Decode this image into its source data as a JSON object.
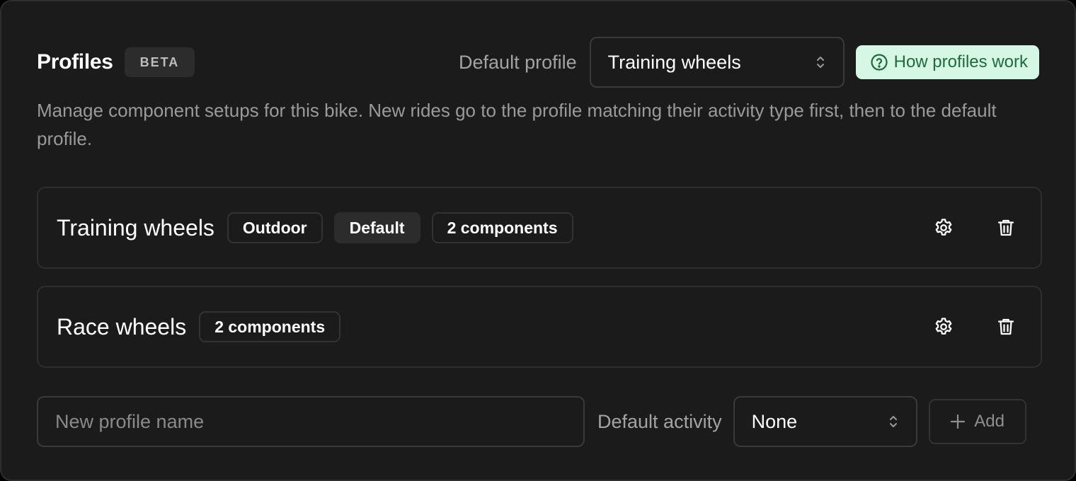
{
  "header": {
    "title": "Profiles",
    "badge": "BETA",
    "default_profile_label": "Default profile",
    "default_profile_value": "Training wheels",
    "help_button_label": "How profiles work"
  },
  "description": "Manage component setups for this bike. New rides go to the profile matching their activity type first, then to the default profile.",
  "profiles": [
    {
      "name": "Training wheels",
      "chips": [
        "Outdoor",
        "Default",
        "2 components"
      ]
    },
    {
      "name": "Race wheels",
      "chips": [
        "2 components"
      ]
    }
  ],
  "add_form": {
    "name_placeholder": "New profile name",
    "activity_label": "Default activity",
    "activity_value": "None",
    "add_label": "Add"
  },
  "icons": {
    "help": "question-circle-icon",
    "select_chevron": "chevron-up-down-icon",
    "settings": "gear-icon",
    "delete": "trash-icon",
    "add": "plus-icon"
  },
  "colors": {
    "panel_bg": "#1b1b1b",
    "help_bg": "#d5f7e3",
    "help_text": "#1f6b3d"
  }
}
